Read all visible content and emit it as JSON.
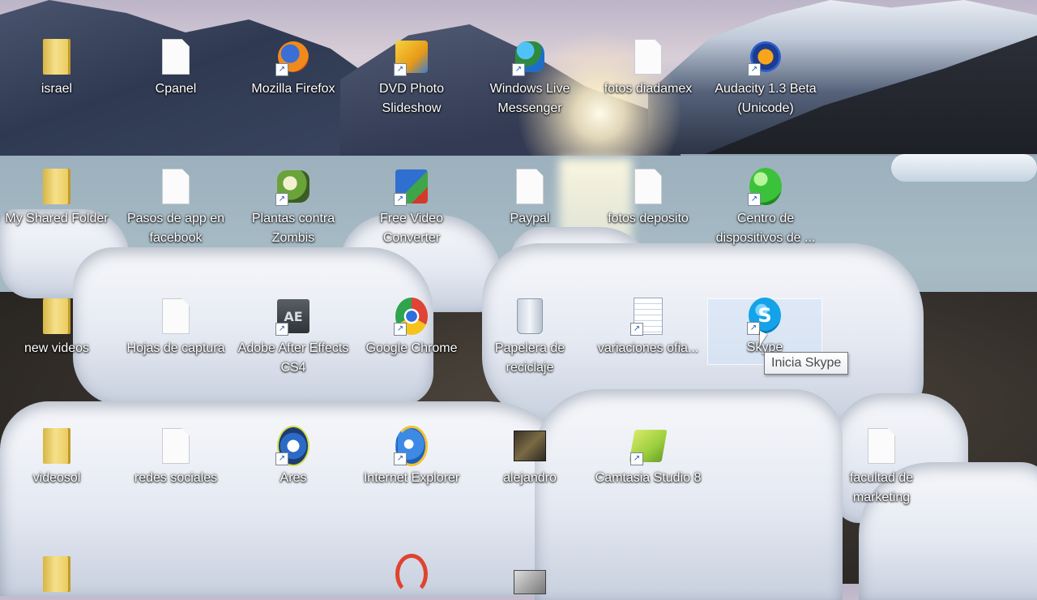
{
  "desktop": {
    "icons": [
      {
        "label": "israel",
        "icon": "folder-icon"
      },
      {
        "label": "Cpanel",
        "icon": "document-icon"
      },
      {
        "label": "Mozilla Firefox",
        "icon": "firefox-icon"
      },
      {
        "label": "DVD Photo Slideshow",
        "icon": "dvd-photo-slideshow-icon"
      },
      {
        "label": "Windows Live Messenger",
        "icon": "messenger-icon"
      },
      {
        "label": "fotos diadamex",
        "icon": "document-icon"
      },
      {
        "label": "Audacity 1.3 Beta (Unicode)",
        "icon": "audacity-icon"
      },
      {
        "label": "My Shared Folder",
        "icon": "folder-icon"
      },
      {
        "label": "Pasos de app en facebook",
        "icon": "document-icon"
      },
      {
        "label": "Plantas contra Zombis",
        "icon": "plants-vs-zombies-icon"
      },
      {
        "label": "Free Video Converter",
        "icon": "video-converter-icon"
      },
      {
        "label": "Paypal",
        "icon": "document-icon"
      },
      {
        "label": "fotos deposito",
        "icon": "document-icon"
      },
      {
        "label": "Centro de dispositivos de ...",
        "icon": "device-center-icon"
      },
      {
        "label": "new videos",
        "icon": "folder-icon"
      },
      {
        "label": "Hojas de captura",
        "icon": "document-icon"
      },
      {
        "label": "Adobe After Effects CS4",
        "icon": "after-effects-icon"
      },
      {
        "label": "Google Chrome",
        "icon": "chrome-icon"
      },
      {
        "label": "Papelera de reciclaje",
        "icon": "recycle-bin-icon"
      },
      {
        "label": "variaciones ofia...",
        "icon": "word-document-icon"
      },
      {
        "label": "Skype",
        "icon": "skype-icon"
      },
      {
        "label": "videosol",
        "icon": "folder-icon"
      },
      {
        "label": "redes sociales",
        "icon": "document-icon"
      },
      {
        "label": "Ares",
        "icon": "ares-icon"
      },
      {
        "label": "Internet Explorer",
        "icon": "internet-explorer-icon"
      },
      {
        "label": "alejandro",
        "icon": "image-icon"
      },
      {
        "label": "Camtasia Studio 8",
        "icon": "camtasia-icon"
      },
      {
        "label": "facultad de marketing",
        "icon": "document-icon"
      }
    ],
    "tooltip": "Inicia Skype",
    "shortcut_arrow": "↗"
  }
}
